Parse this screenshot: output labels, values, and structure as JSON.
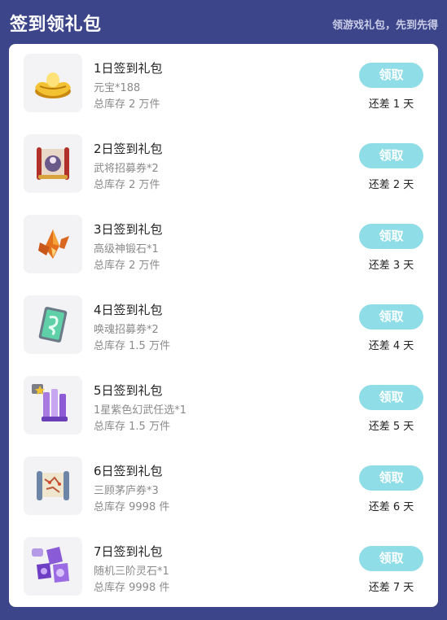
{
  "header": {
    "title": "签到领礼包",
    "subtitle": "领游戏礼包，先到先得"
  },
  "colors": {
    "background": "#3c4589",
    "card": "#ffffff",
    "claim_button": "#8fdde7",
    "thumb_bg": "#f3f3f5"
  },
  "gifts": [
    {
      "name": "1日签到礼包",
      "reward": "元宝*188",
      "stock": "总库存 2 万件",
      "button": "领取",
      "remaining": "还差 1 天",
      "icon": "gold-ingot-icon"
    },
    {
      "name": "2日签到礼包",
      "reward": "武将招募券*2",
      "stock": "总库存 2 万件",
      "button": "领取",
      "remaining": "还差 2 天",
      "icon": "general-recruit-scroll-icon"
    },
    {
      "name": "3日签到礼包",
      "reward": "高级神锻石*1",
      "stock": "总库存 2 万件",
      "button": "领取",
      "remaining": "还差 3 天",
      "icon": "forging-stone-icon"
    },
    {
      "name": "4日签到礼包",
      "reward": "唤魂招募券*2",
      "stock": "总库存 1.5 万件",
      "button": "领取",
      "remaining": "还差 4 天",
      "icon": "soul-recruit-card-icon"
    },
    {
      "name": "5日签到礼包",
      "reward": "1星紫色幻武任选*1",
      "stock": "总库存 1.5 万件",
      "button": "领取",
      "remaining": "还差 5 天",
      "icon": "purple-weapon-chest-icon"
    },
    {
      "name": "6日签到礼包",
      "reward": "三顾茅庐券*3",
      "stock": "总库存 9998 件",
      "button": "领取",
      "remaining": "还差 6 天",
      "icon": "map-scroll-icon"
    },
    {
      "name": "7日签到礼包",
      "reward": "随机三阶灵石*1",
      "stock": "总库存 9998 件",
      "button": "领取",
      "remaining": "还差 7 天",
      "icon": "spirit-gems-icon"
    }
  ]
}
